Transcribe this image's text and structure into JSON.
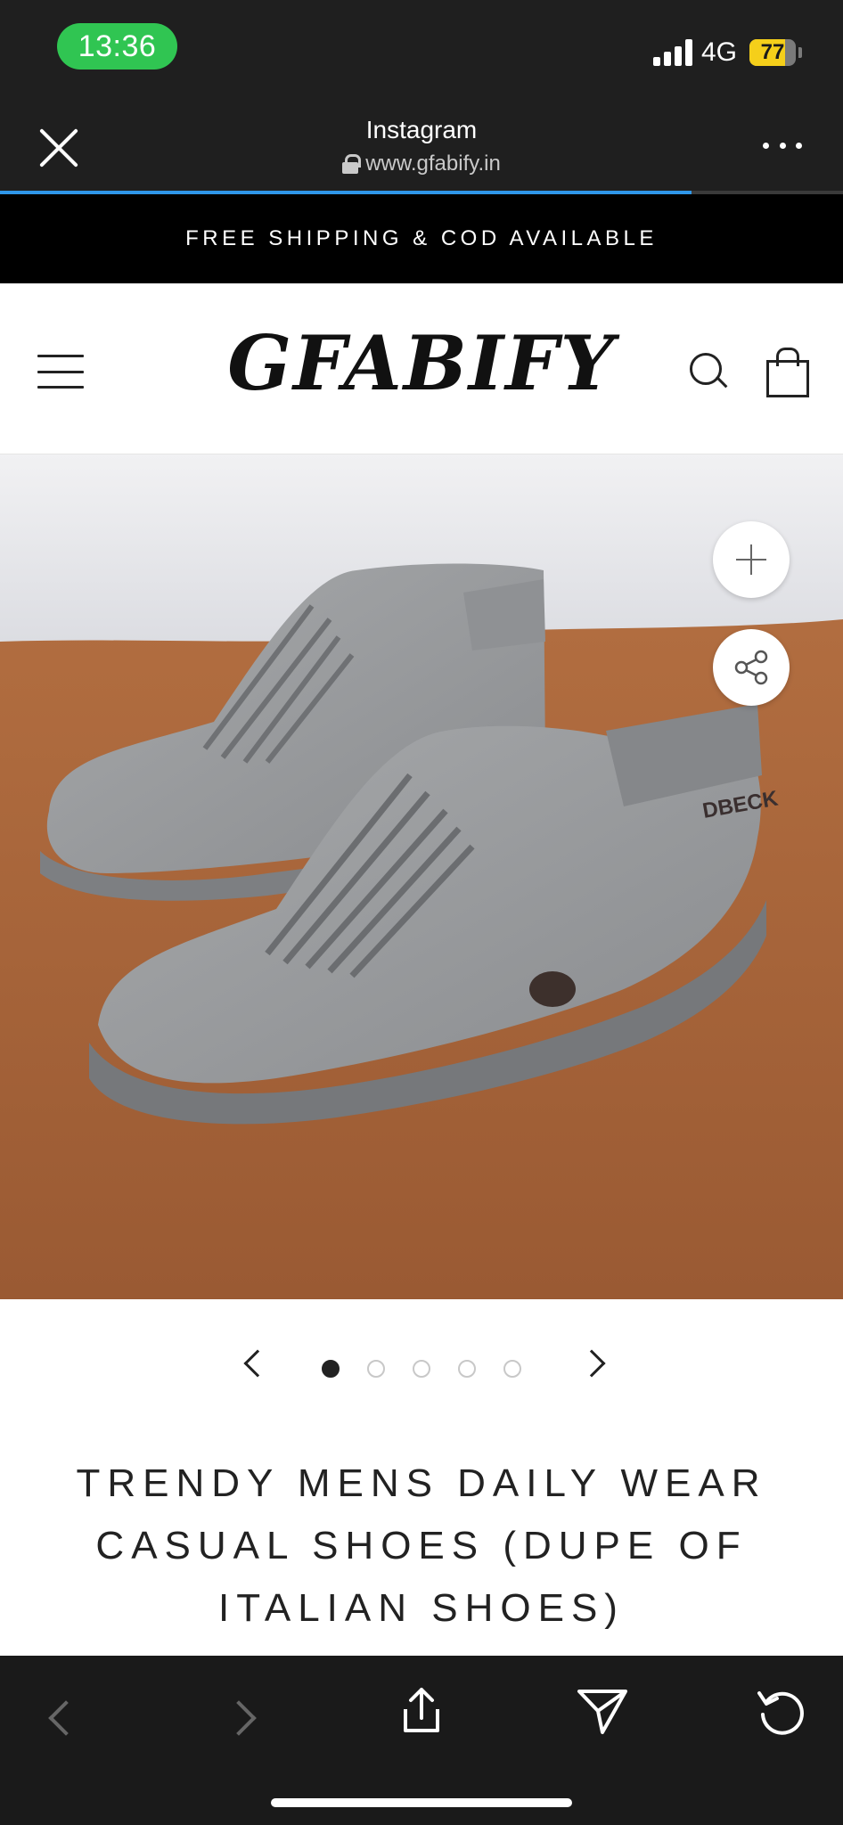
{
  "status_bar": {
    "time": "13:36",
    "network": "4G",
    "battery_level": "77",
    "colors": {
      "time_pill": "#30c552",
      "battery": "#f5cf1a"
    }
  },
  "browser": {
    "title": "Instagram",
    "url": "www.gfabify.in",
    "load_progress": 0.82,
    "icons": {
      "close": "close-icon",
      "secure": "lock-icon",
      "more": "more-icon"
    }
  },
  "announcement": {
    "text": "FREE SHIPPING & COD AVAILABLE"
  },
  "site_header": {
    "logo": "GFABIFY",
    "icons": {
      "menu": "hamburger-icon",
      "search": "search-icon",
      "cart": "bag-icon"
    }
  },
  "product_image": {
    "brand_mark": "DBECK",
    "icons": {
      "zoom": "plus-icon",
      "share": "share-icon"
    }
  },
  "carousel": {
    "total_slides": 5,
    "active_slide": 1,
    "icons": {
      "prev": "chevron-left-icon",
      "next": "chevron-right-icon"
    }
  },
  "product": {
    "title_lines": [
      "TRENDY MENS DAILY WEAR",
      "CASUAL SHOES (DUPE OF",
      "ITALIAN SHOES)"
    ]
  },
  "bottom_toolbar": {
    "icons": [
      "back-icon",
      "forward-icon",
      "share-upload-icon",
      "send-icon",
      "reload-icon"
    ]
  }
}
